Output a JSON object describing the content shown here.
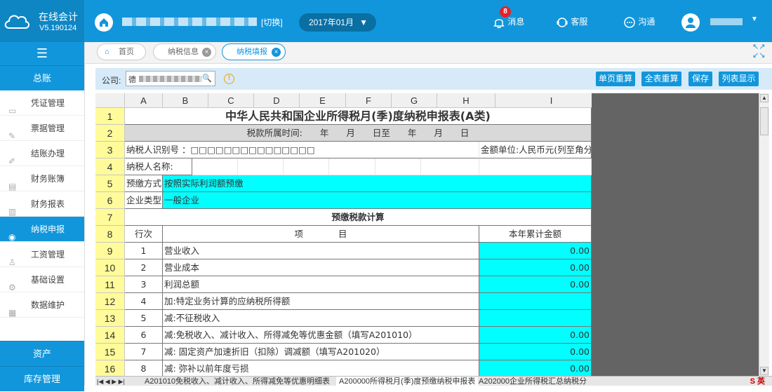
{
  "app": {
    "name": "在线会计",
    "version": "V5.190124"
  },
  "topbar": {
    "switch_label": "[切换]",
    "period": "2017年01月",
    "messages_label": "消息",
    "messages_badge": "8",
    "service_label": "客服",
    "chat_label": "沟通"
  },
  "sidebar": {
    "collapse_glyph": "☰",
    "section_main": "总账",
    "items": [
      {
        "label": "凭证管理",
        "icon": "voucher-icon"
      },
      {
        "label": "票据管理",
        "icon": "invoice-icon"
      },
      {
        "label": "结账办理",
        "icon": "pen-icon"
      },
      {
        "label": "财务账簿",
        "icon": "ledger-icon"
      },
      {
        "label": "财务报表",
        "icon": "bar-chart-icon"
      },
      {
        "label": "纳税申报",
        "icon": "tax-icon",
        "active": true
      },
      {
        "label": "工资管理",
        "icon": "salary-icon"
      },
      {
        "label": "基础设置",
        "icon": "settings-icon"
      },
      {
        "label": "数据维护",
        "icon": "database-icon"
      }
    ],
    "section_assets": "资产",
    "section_inventory": "库存管理"
  },
  "tabs": [
    {
      "label": "首页",
      "closable": false
    },
    {
      "label": "纳税信息",
      "closable": true
    },
    {
      "label": "纳税填报",
      "closable": true,
      "active": true
    }
  ],
  "toolbar": {
    "company_label": "公司:",
    "company_first_char": "德",
    "buttons": [
      "单页重算",
      "全表重算",
      "保存",
      "列表显示"
    ]
  },
  "sheet": {
    "columns": [
      "A",
      "B",
      "C",
      "D",
      "E",
      "F",
      "G",
      "H",
      "I"
    ],
    "rows": [
      "1",
      "2",
      "3",
      "4",
      "5",
      "6",
      "7",
      "8",
      "9",
      "10",
      "11",
      "12",
      "13",
      "14",
      "15",
      "16"
    ],
    "title": "中华人民共和国企业所得税月(季)度纳税申报表(A类)",
    "period_line": "税款所属时间:　　年　　月　　日至　　年　　月　　日",
    "taxpayer_id": "纳税人识别号 ：□□□□□□□□□□□□□□□",
    "amount_unit": "金额单位:人民币元(列至角分)",
    "taxpayer_name": "纳税人名称:",
    "prepay_label": "预缴方式:",
    "prepay_value": "按照实际利润额预缴",
    "enterprise_label": "企业类型:",
    "enterprise_value": "一般企业",
    "section_title": "预缴税款计算",
    "header_line": "行次",
    "header_item": "项　　　　目",
    "header_amount": "本年累计金额",
    "lines": [
      {
        "no": "1",
        "item": "营业收入",
        "amount": "0.00"
      },
      {
        "no": "2",
        "item": "营业成本",
        "amount": "0.00"
      },
      {
        "no": "3",
        "item": "利润总额",
        "amount": "0.00"
      },
      {
        "no": "4",
        "item": "加:特定业务计算的应纳税所得额",
        "amount": ""
      },
      {
        "no": "5",
        "item": "减:不征税收入",
        "amount": ""
      },
      {
        "no": "6",
        "item": "减:免税收入、减计收入、所得减免等优惠金额（填写A201010）",
        "amount": "0.00"
      },
      {
        "no": "7",
        "item": "减: 固定资产加速折旧（扣除）调减额（填写A201020）",
        "amount": "0.00"
      },
      {
        "no": "8",
        "item": "减: 弥补以前年度亏损",
        "amount": "0.00"
      }
    ]
  },
  "sheet_tabs": [
    "A201010免税收入、减计收入、所得减免等优惠明细表",
    "A200000所得税月(季)度预缴纳税申报表",
    "A202000企业所得税汇总纳税分"
  ],
  "ime": "S 英"
}
